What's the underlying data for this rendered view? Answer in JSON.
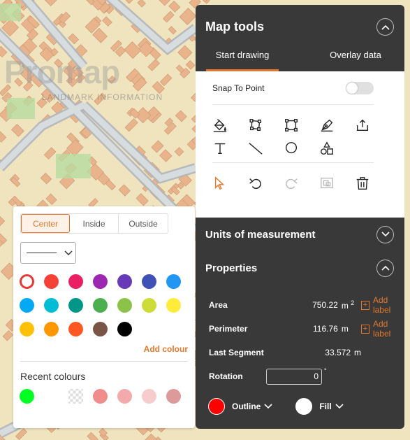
{
  "watermark": {
    "brand": "Promap",
    "sub": "LANDMARK INFORMATION"
  },
  "map_tools": {
    "title": "Map tools",
    "tabs": [
      "Start drawing",
      "Overlay data"
    ],
    "active_tab": 0,
    "snap_label": "Snap To Point",
    "snap_on": false,
    "draw_tools": [
      "fill-icon",
      "edit-vertices-icon",
      "rectangle-select-icon",
      "pen-icon",
      "upload-icon",
      "text-icon",
      "line-icon",
      "circle-icon",
      "shapes-icon"
    ],
    "actions": [
      "pointer-icon",
      "undo-icon",
      "redo-icon",
      "merge-icon",
      "trash-icon"
    ],
    "units_title": "Units of measurement",
    "properties_title": "Properties",
    "properties": {
      "area": {
        "label": "Area",
        "value": "750.22",
        "unit": "m",
        "sup": "2",
        "add_label": "Add label"
      },
      "perimeter": {
        "label": "Perimeter",
        "value": "116.76",
        "unit": "m",
        "add_label": "Add label"
      },
      "last_segment": {
        "label": "Last Segment",
        "value": "33.572",
        "unit": "m"
      },
      "rotation": {
        "label": "Rotation",
        "value": "0",
        "unit": "°"
      }
    },
    "outline_label": "Outline",
    "fill_label": "Fill",
    "outline_color": "#ff0000",
    "fill_color": "#ffffff"
  },
  "palette": {
    "segments": [
      "Center",
      "Inside",
      "Outside"
    ],
    "active_segment": 0,
    "colors": [
      "#ffffff",
      "#f44336",
      "#e91e63",
      "#9c27b0",
      "#673ab7",
      "#3f51b5",
      "#2196f3",
      "#03a9f4",
      "#00bcd4",
      "#009688",
      "#4caf50",
      "#8bc34a",
      "#cddc39",
      "#ffeb3b",
      "#ffc107",
      "#ff9800",
      "#ff5722",
      "#795548",
      "#000000"
    ],
    "selected_index": 0,
    "add_colour": "Add colour",
    "recent_title": "Recent colours",
    "recent": [
      "#00ff22",
      "transparent",
      "checker",
      "#f08c8c",
      "#f3aaaa",
      "#f6cccc",
      "#dc9a9a"
    ],
    "accent": "#e3782b"
  }
}
